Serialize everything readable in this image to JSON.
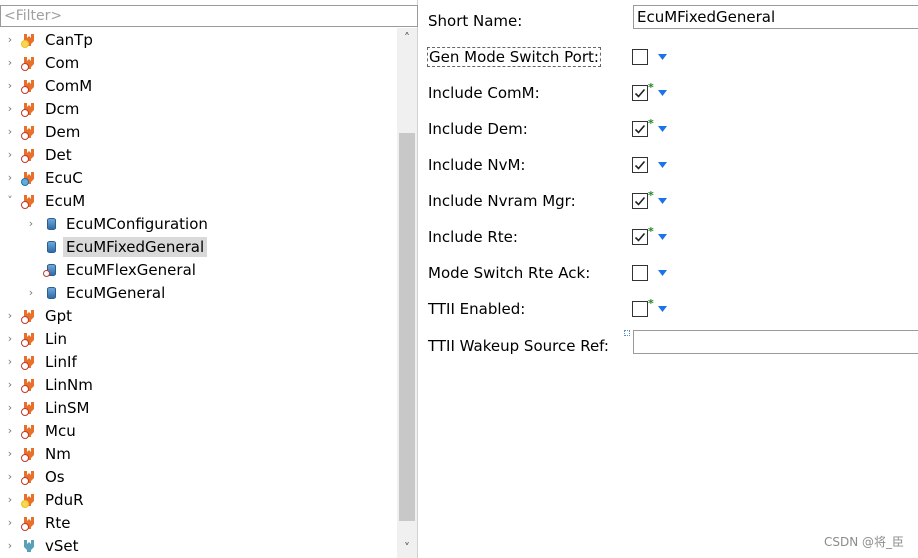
{
  "filter": {
    "placeholder": "<Filter>"
  },
  "tree": [
    {
      "label": "CanTp",
      "type": "module",
      "expanded": false,
      "badge": "ok",
      "level": 0
    },
    {
      "label": "Com",
      "type": "module",
      "expanded": false,
      "badge": "error",
      "level": 0
    },
    {
      "label": "ComM",
      "type": "module",
      "expanded": false,
      "badge": "error",
      "level": 0
    },
    {
      "label": "Dcm",
      "type": "module",
      "expanded": false,
      "badge": "error",
      "level": 0
    },
    {
      "label": "Dem",
      "type": "module",
      "expanded": false,
      "badge": "error",
      "level": 0
    },
    {
      "label": "Det",
      "type": "module",
      "expanded": false,
      "badge": "error",
      "level": 0
    },
    {
      "label": "EcuC",
      "type": "module",
      "expanded": false,
      "badge": "info",
      "level": 0
    },
    {
      "label": "EcuM",
      "type": "module",
      "expanded": true,
      "badge": "error",
      "level": 0
    },
    {
      "label": "EcuMConfiguration",
      "type": "container",
      "expanded": false,
      "badge": "none",
      "level": 1
    },
    {
      "label": "EcuMFixedGeneral",
      "type": "container",
      "expanded": null,
      "badge": "none",
      "level": 1,
      "selected": true
    },
    {
      "label": "EcuMFlexGeneral",
      "type": "container",
      "expanded": null,
      "badge": "error",
      "level": 1
    },
    {
      "label": "EcuMGeneral",
      "type": "container",
      "expanded": false,
      "badge": "none",
      "level": 1
    },
    {
      "label": "Gpt",
      "type": "module",
      "expanded": false,
      "badge": "error",
      "level": 0
    },
    {
      "label": "Lin",
      "type": "module",
      "expanded": false,
      "badge": "error",
      "level": 0
    },
    {
      "label": "LinIf",
      "type": "module",
      "expanded": false,
      "badge": "error",
      "level": 0
    },
    {
      "label": "LinNm",
      "type": "module",
      "expanded": false,
      "badge": "error",
      "level": 0
    },
    {
      "label": "LinSM",
      "type": "module",
      "expanded": false,
      "badge": "error",
      "level": 0
    },
    {
      "label": "Mcu",
      "type": "module",
      "expanded": false,
      "badge": "error",
      "level": 0
    },
    {
      "label": "Nm",
      "type": "module",
      "expanded": false,
      "badge": "error",
      "level": 0
    },
    {
      "label": "Os",
      "type": "module",
      "expanded": false,
      "badge": "error",
      "level": 0
    },
    {
      "label": "PduR",
      "type": "module",
      "expanded": false,
      "badge": "ok",
      "level": 0
    },
    {
      "label": "Rte",
      "type": "module",
      "expanded": false,
      "badge": "error",
      "level": 0
    },
    {
      "label": "vSet",
      "type": "module-blue",
      "expanded": false,
      "badge": "none",
      "level": 0
    }
  ],
  "properties": {
    "short_name": {
      "label": "Short Name:",
      "value": "EcuMFixedGeneral"
    },
    "rows": [
      {
        "label": "Gen Mode Switch Port:",
        "checked": false,
        "modified": false,
        "focused": true
      },
      {
        "label": "Include ComM:",
        "checked": true,
        "modified": true
      },
      {
        "label": "Include Dem:",
        "checked": true,
        "modified": true
      },
      {
        "label": "Include NvM:",
        "checked": true,
        "modified": false
      },
      {
        "label": "Include Nvram Mgr:",
        "checked": true,
        "modified": true
      },
      {
        "label": "Include Rte:",
        "checked": true,
        "modified": true
      },
      {
        "label": "Mode Switch Rte Ack:",
        "checked": false,
        "modified": false
      },
      {
        "label": "TTII Enabled:",
        "checked": false,
        "modified": true
      }
    ],
    "wakeup_ref": {
      "label": "TTII Wakeup Source Ref:",
      "value": ""
    }
  },
  "colors": {
    "module_orange": "#e8702a",
    "vset_blue": "#5aa0b8",
    "dropdown_blue": "#1a73e8",
    "modified_star": "#1e8a1e"
  },
  "watermark": "CSDN @将_臣"
}
